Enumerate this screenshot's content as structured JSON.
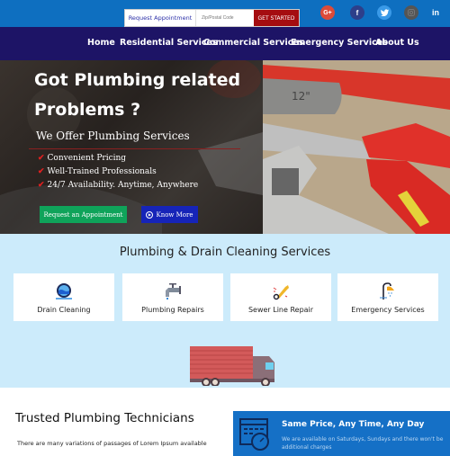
{
  "topbar": {
    "appointment_label": "Request Appointment",
    "zip_placeholder": "Zip/Postal Code",
    "get_started_label": "GET STARTED",
    "social": [
      {
        "name": "google-plus-icon",
        "glyph": "G+",
        "color": "#dd4b39"
      },
      {
        "name": "facebook-icon",
        "glyph": "f",
        "color": "#2d3f8a"
      },
      {
        "name": "twitter-icon",
        "glyph": "t",
        "color": "#3a9ae8"
      },
      {
        "name": "instagram-icon",
        "glyph": "◎",
        "color": "#555555"
      },
      {
        "name": "linkedin-icon",
        "glyph": "in",
        "color": "transparent"
      }
    ]
  },
  "nav": {
    "items": [
      "Home",
      "Residential Services",
      "Commercial Services",
      "Emergency Services",
      "About Us"
    ]
  },
  "hero": {
    "title_line1": "Got Plumbing related",
    "title_line2": "Problems ?",
    "subtitle": "We Offer Plumbing Services",
    "checks": [
      "Convenient Pricing",
      "Well-Trained Professionals",
      "24/7 Availability. Anytime, Anywhere"
    ],
    "check_glyph": "✔",
    "primary_button": "Request an Appointment",
    "secondary_button": "Know More",
    "secondary_icon": "▶"
  },
  "services": {
    "title": "Plumbing & Drain Cleaning Services",
    "cards": [
      {
        "label": "Drain Cleaning",
        "icon": "drain-icon"
      },
      {
        "label": "Plumbing Repairs",
        "icon": "faucet-icon"
      },
      {
        "label": "Sewer Line Repair",
        "icon": "wrench-icon"
      },
      {
        "label": "Emergency Services",
        "icon": "shower-icon"
      }
    ]
  },
  "trusted": {
    "title": "Trusted Plumbing Technicians",
    "text": "There are many variations of passages of Lorem Ipsum available"
  },
  "feature": {
    "title": "Same Price, Any Time, Any Day",
    "text": "We are available on Saturdays, Sundays and there won't be additional charges"
  },
  "colors": {
    "topbar": "#0e6fc0",
    "navbar": "#1d1466",
    "cta_red": "#a50d10",
    "cta_green": "#0fa35a",
    "cta_blue": "#1624b8",
    "services_bg": "#ccebfb"
  }
}
